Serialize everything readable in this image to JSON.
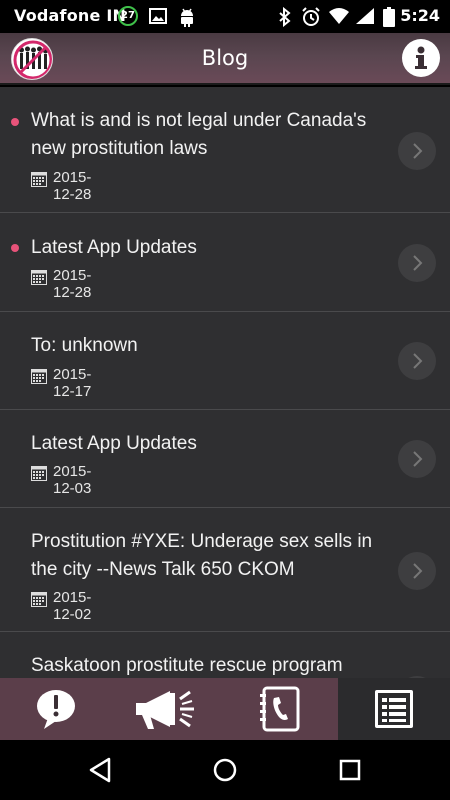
{
  "status_bar": {
    "carrier": "Vodafone IN",
    "notification_count": "27",
    "time": "5:24"
  },
  "app_bar": {
    "title": "Blog"
  },
  "posts": [
    {
      "title": "What is and is not legal under Canada's new prostitution laws",
      "date": "2015-12-28",
      "unread": true
    },
    {
      "title": "Latest App Updates",
      "date": "2015-12-28",
      "unread": true
    },
    {
      "title": "To: unknown",
      "date": "2015-12-17",
      "unread": false
    },
    {
      "title": "Latest App Updates",
      "date": "2015-12-03",
      "unread": false
    },
    {
      "title": "Prostitution #YXE: Underage sex sells in the city --News Talk 650 CKOM",
      "date": "2015-12-02",
      "unread": false
    },
    {
      "title": "Saskatoon prostitute rescue program",
      "date": "",
      "unread": false
    }
  ],
  "tabs": [
    {
      "icon": "alert-bubble-icon",
      "active": false
    },
    {
      "icon": "megaphone-icon",
      "active": false
    },
    {
      "icon": "phonebook-icon",
      "active": false
    },
    {
      "icon": "list-icon",
      "active": true
    }
  ],
  "nav": {
    "buttons": [
      "back-icon",
      "home-icon",
      "recents-icon"
    ]
  },
  "colors": {
    "accent_dot": "#e8537a",
    "app_bar": "#5a4650",
    "tab_bar": "#5b3e4a",
    "list_bg": "#2f2f31"
  }
}
